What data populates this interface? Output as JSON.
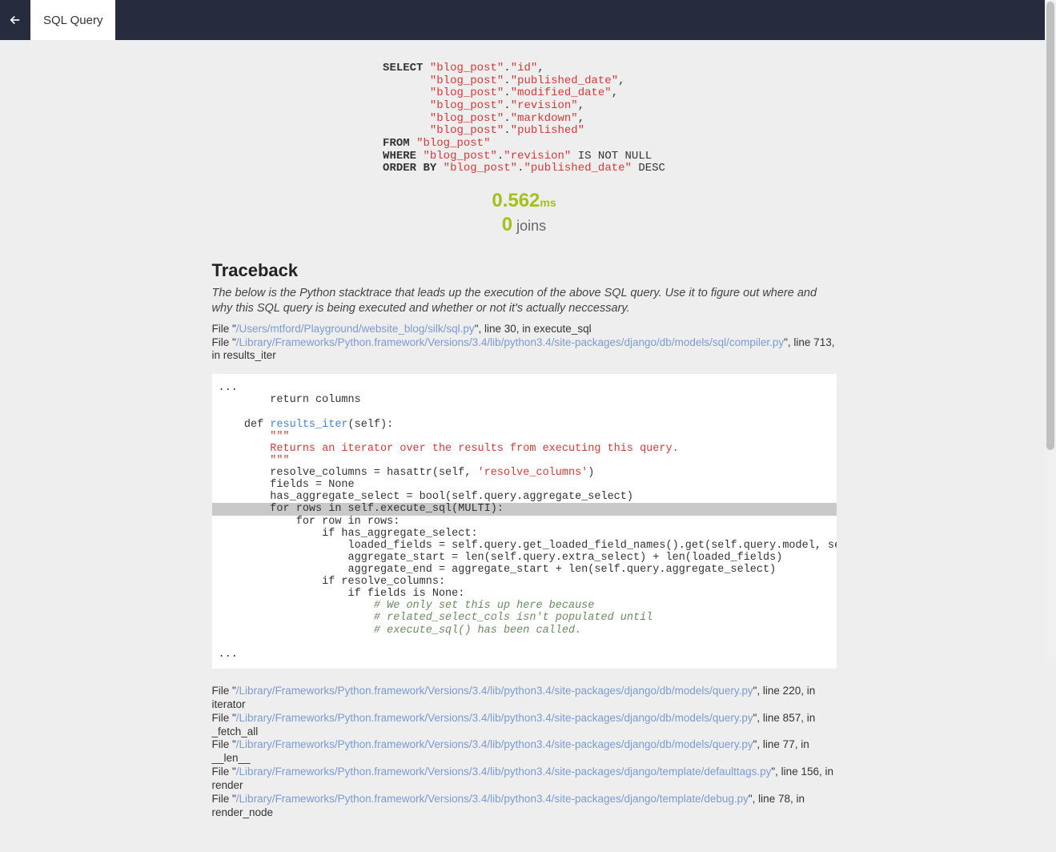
{
  "header": {
    "tab_label": "SQL Query"
  },
  "sql": {
    "select": "SELECT",
    "cols": [
      {
        "tbl": "\"blog_post\"",
        "col": "\"id\""
      },
      {
        "tbl": "\"blog_post\"",
        "col": "\"published_date\""
      },
      {
        "tbl": "\"blog_post\"",
        "col": "\"modified_date\""
      },
      {
        "tbl": "\"blog_post\"",
        "col": "\"revision\""
      },
      {
        "tbl": "\"blog_post\"",
        "col": "\"markdown\""
      },
      {
        "tbl": "\"blog_post\"",
        "col": "\"published\""
      }
    ],
    "from": "FROM",
    "from_tbl": "\"blog_post\"",
    "where": "WHERE",
    "where_tbl": "\"blog_post\"",
    "where_col": "\"revision\"",
    "where_tail": " IS NOT NULL",
    "orderby": "ORDER BY",
    "orderby_tbl": "\"blog_post\"",
    "orderby_col": "\"published_date\"",
    "orderby_dir": " DESC"
  },
  "stats": {
    "time_value": "0.562",
    "time_unit": "ms",
    "joins_value": "0",
    "joins_label": " joins"
  },
  "traceback": {
    "heading": "Traceback",
    "description": "The below is the Python stacktrace that leads up the execution of the above SQL query. Use it to figure out where and why this SQL query is being executed and whether or not it's actually neccessary.",
    "top_lines": [
      {
        "prefix": "File \"",
        "path": "/Users/mtford/Playground/website_blog/silk/sql.py",
        "suffix": "\", line 30, in execute_sql"
      },
      {
        "prefix": "File \"",
        "path": "/Library/Frameworks/Python.framework/Versions/3.4/lib/python3.4/site-packages/django/db/models/sql/compiler.py",
        "suffix": "\", line 713, in results_iter"
      }
    ],
    "bottom_lines": [
      {
        "prefix": "File \"",
        "path": "/Library/Frameworks/Python.framework/Versions/3.4/lib/python3.4/site-packages/django/db/models/query.py",
        "suffix": "\", line 220, in iterator"
      },
      {
        "prefix": "File \"",
        "path": "/Library/Frameworks/Python.framework/Versions/3.4/lib/python3.4/site-packages/django/db/models/query.py",
        "suffix": "\", line 857, in _fetch_all"
      },
      {
        "prefix": "File \"",
        "path": "/Library/Frameworks/Python.framework/Versions/3.4/lib/python3.4/site-packages/django/db/models/query.py",
        "suffix": "\", line 77, in __len__"
      },
      {
        "prefix": "File \"",
        "path": "/Library/Frameworks/Python.framework/Versions/3.4/lib/python3.4/site-packages/django/template/defaulttags.py",
        "suffix": "\", line 156, in render"
      },
      {
        "prefix": "File \"",
        "path": "/Library/Frameworks/Python.framework/Versions/3.4/lib/python3.4/site-packages/django/template/debug.py",
        "suffix": "\", line 78, in render_node"
      }
    ]
  },
  "code": {
    "ellipsis": "...",
    "l1": "        return columns",
    "l2": "",
    "l3a": "    def ",
    "l3b": "results_iter",
    "l3c": "(self):",
    "l4": "        \"\"\"",
    "l5": "        Returns an iterator over the results from executing this query.",
    "l6": "        \"\"\"",
    "l7a": "        resolve_columns = hasattr(self, ",
    "l7b": "'resolve_columns'",
    "l7c": ")",
    "l8": "        fields = None",
    "l9": "        has_aggregate_select = bool(self.query.aggregate_select)",
    "l10": "        for rows in self.execute_sql(MULTI):",
    "l11": "            for row in rows:",
    "l12": "                if has_aggregate_select:",
    "l13": "                    loaded_fields = self.query.get_loaded_field_names().get(self.query.model, set()) or self.query.select",
    "l14": "                    aggregate_start = len(self.query.extra_select) + len(loaded_fields)",
    "l15": "                    aggregate_end = aggregate_start + len(self.query.aggregate_select)",
    "l16": "                if resolve_columns:",
    "l17": "                    if fields is None:",
    "l18": "                        # We only set this up here because",
    "l19": "                        # related_select_cols isn't populated until",
    "l20": "                        # execute_sql() has been called."
  }
}
